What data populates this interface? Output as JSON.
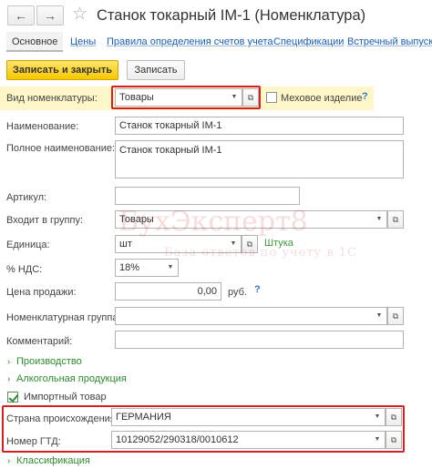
{
  "window": {
    "title": "Станок токарный IM-1 (Номенклатура)",
    "back_icon": "←",
    "forward_icon": "→",
    "star_icon": "☆"
  },
  "tabs": [
    {
      "label": "Основное"
    },
    {
      "label": "Цены"
    },
    {
      "label": "Правила определения счетов учета"
    },
    {
      "label": "Спецификации"
    },
    {
      "label": "Встречный выпуск"
    }
  ],
  "toolbar": {
    "save_close_label": "Записать и закрыть",
    "save_label": "Записать"
  },
  "form": {
    "kind": {
      "label": "Вид номенклатуры:",
      "value": "Товары"
    },
    "fur": {
      "label": "Меховое изделие",
      "checked": false,
      "help": "?"
    },
    "name": {
      "label": "Наименование:",
      "value": "Станок токарный IM-1"
    },
    "full_name": {
      "label": "Полное наименование:",
      "value": "Станок токарный IM-1"
    },
    "article": {
      "label": "Артикул:",
      "value": ""
    },
    "group": {
      "label": "Входит в группу:",
      "value": "Товары"
    },
    "unit": {
      "label": "Единица:",
      "value": "шт",
      "full": "Штука"
    },
    "vat": {
      "label": "% НДС:",
      "value": "18%"
    },
    "price": {
      "label": "Цена продажи:",
      "value": "0,00",
      "currency": "руб.",
      "help": "?"
    },
    "nom_group": {
      "label": "Номенклатурная группа:",
      "value": ""
    },
    "comment": {
      "label": "Комментарий:",
      "value": ""
    },
    "origin": {
      "label": "Страна происхождения:",
      "value": "ГЕРМАНИЯ"
    },
    "gtd": {
      "label": "Номер ГТД:",
      "value": "10129052/290318/0010612"
    }
  },
  "sections": {
    "production": "Производство",
    "alcohol": "Алкогольная продукция",
    "imported": "Импортный товар",
    "imported_checked": true,
    "classification": "Классификация"
  },
  "watermark": {
    "brand": "БухЭксперт8",
    "tagline": "База ответов по учету в 1С"
  },
  "colors": {
    "accent_yellow": "#f5c800",
    "highlight_red": "#d42020",
    "link_blue": "#1b5fb3",
    "group_green": "#2e8b2e"
  }
}
